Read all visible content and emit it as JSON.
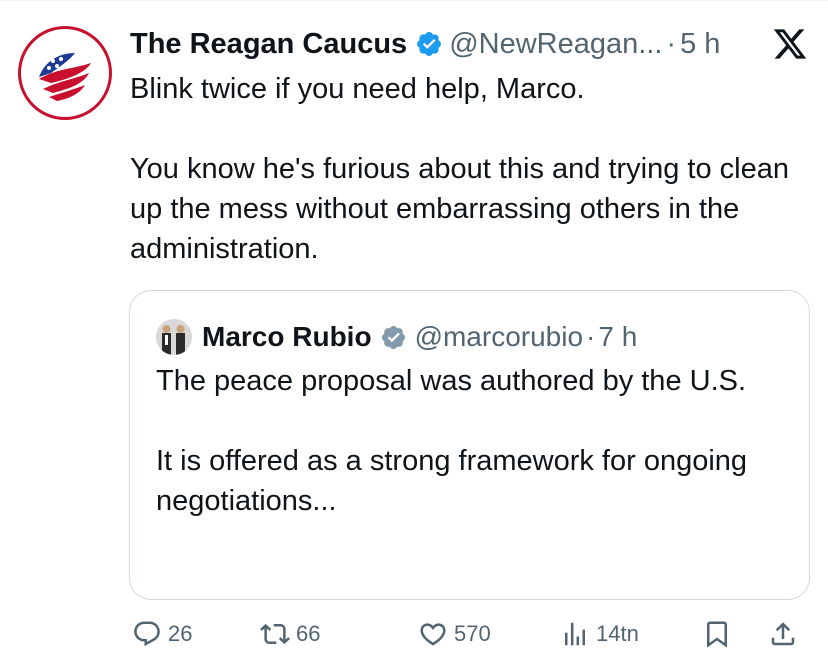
{
  "tweet": {
    "display_name": "The Reagan Caucus",
    "handle": "@NewReagan...",
    "separator": "·",
    "time": "5 h",
    "text": {
      "line1": "Blink twice if you need help, Marco.",
      "para2": "You know he's furious about this and trying to clean up the mess without embarrassing others in the administration."
    }
  },
  "quote": {
    "display_name": "Marco Rubio",
    "handle": "@marcorubio",
    "separator": "·",
    "time": "7 h",
    "text": {
      "para1": "The peace proposal was authored by the U.S.",
      "para2": "It is offered as a strong framework for ongoing negotiations..."
    }
  },
  "actions": {
    "replies": "26",
    "reposts": "66",
    "likes": "570",
    "views": "14tn"
  },
  "colors": {
    "text": "#0f1419",
    "secondary": "#536471",
    "verified": "#1d9bf0",
    "border": "#cfd9de",
    "brand_red": "#c8102e",
    "brand_blue": "#1f3a93"
  },
  "icons": [
    "x-logo-icon",
    "verified-badge-icon",
    "reply-icon",
    "retweet-icon",
    "like-icon",
    "views-icon",
    "bookmark-icon",
    "share-icon"
  ]
}
